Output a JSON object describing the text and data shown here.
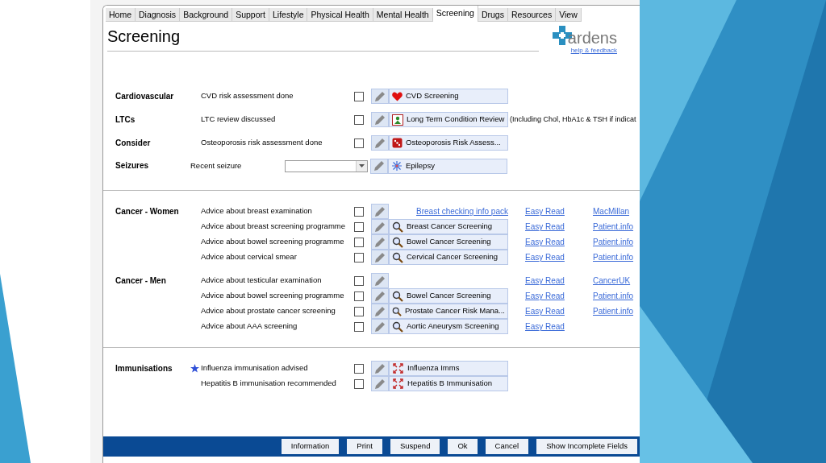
{
  "tabs": [
    {
      "label": "Home",
      "selected": false
    },
    {
      "label": "Diagnosis",
      "selected": false
    },
    {
      "label": "Background",
      "selected": false
    },
    {
      "label": "Support",
      "selected": false
    },
    {
      "label": "Lifestyle",
      "selected": false
    },
    {
      "label": "Physical Health",
      "selected": false
    },
    {
      "label": "Mental Health",
      "selected": false
    },
    {
      "label": "Screening",
      "selected": true
    },
    {
      "label": "Drugs",
      "selected": false
    },
    {
      "label": "Resources",
      "selected": false
    },
    {
      "label": "View",
      "selected": false
    }
  ],
  "title": "Screening",
  "logo": {
    "name": "ardens",
    "link": "help & feedback"
  },
  "sections": [
    {
      "rows": [
        {
          "group": "Cardiovascular",
          "text": "CVD risk assessment done",
          "kind": "checkbox",
          "checked": false,
          "template": {
            "label": "CVD Screening"
          }
        },
        {
          "group": "LTCs",
          "text": "LTC review discussed",
          "kind": "checkbox",
          "checked": false,
          "template": {
            "label": "Long Term Condition Review"
          },
          "note": "(Including Chol, HbA1c & TSH if indicat"
        },
        {
          "group": "Consider",
          "text": "Osteoporosis risk assessment done",
          "kind": "checkbox",
          "checked": false,
          "template": {
            "label": "Osteoporosis Risk Assess..."
          }
        },
        {
          "group": "Seizures",
          "text": "Recent seizure",
          "kind": "dropdown",
          "template": {
            "label": "Epilepsy"
          }
        }
      ]
    },
    {
      "rows": [
        {
          "group": "Cancer - Women",
          "text": "Advice about breast examination",
          "kind": "checkbox",
          "checked": false,
          "link": "Breast checking info pack",
          "easy_read": "Easy Read",
          "resource": "MacMillan"
        },
        {
          "text": "Advice about breast screening programme",
          "kind": "checkbox",
          "checked": false,
          "template": {
            "label": "Breast Cancer Screening"
          },
          "easy_read": "Easy Read",
          "resource": "Patient.info"
        },
        {
          "text": "Advice about bowel screening programme",
          "kind": "checkbox",
          "checked": false,
          "template": {
            "label": "Bowel Cancer Screening"
          },
          "easy_read": "Easy Read",
          "resource": "Patient.info"
        },
        {
          "text": "Advice about cervical smear",
          "kind": "checkbox",
          "checked": false,
          "template": {
            "label": "Cervical Cancer Screening"
          },
          "easy_read": "Easy Read",
          "resource": "Patient.info"
        },
        {
          "group": "Cancer - Men",
          "text": "Advice about testicular examination",
          "kind": "checkbox",
          "checked": false,
          "easy_read": "Easy Read",
          "resource": "CancerUK"
        },
        {
          "text": "Advice about bowel screening programme",
          "kind": "checkbox",
          "checked": false,
          "template": {
            "label": "Bowel Cancer Screening"
          },
          "easy_read": "Easy Read",
          "resource": "Patient.info"
        },
        {
          "text": "Advice about prostate cancer screening",
          "kind": "checkbox",
          "checked": false,
          "template": {
            "label": "Prostate Cancer Risk Mana..."
          },
          "easy_read": "Easy Read",
          "resource": "Patient.info"
        },
        {
          "text": "Advice about AAA screening",
          "kind": "checkbox",
          "checked": false,
          "template": {
            "label": "Aortic Aneurysm Screening"
          },
          "easy_read": "Easy Read"
        }
      ]
    },
    {
      "rows": [
        {
          "group": "Immunisations",
          "starred": true,
          "text": "Influenza immunisation advised",
          "kind": "checkbox",
          "checked": false,
          "template": {
            "label": "Influenza Imms"
          }
        },
        {
          "starred": false,
          "text": "Hepatitis B immunisation recommended",
          "kind": "checkbox",
          "checked": false,
          "template": {
            "label": "Hepatitis B Immunisation"
          }
        }
      ]
    }
  ],
  "buttons": [
    "Information",
    "Print",
    "Suspend",
    "Ok",
    "Cancel",
    "Show Incomplete Fields"
  ]
}
